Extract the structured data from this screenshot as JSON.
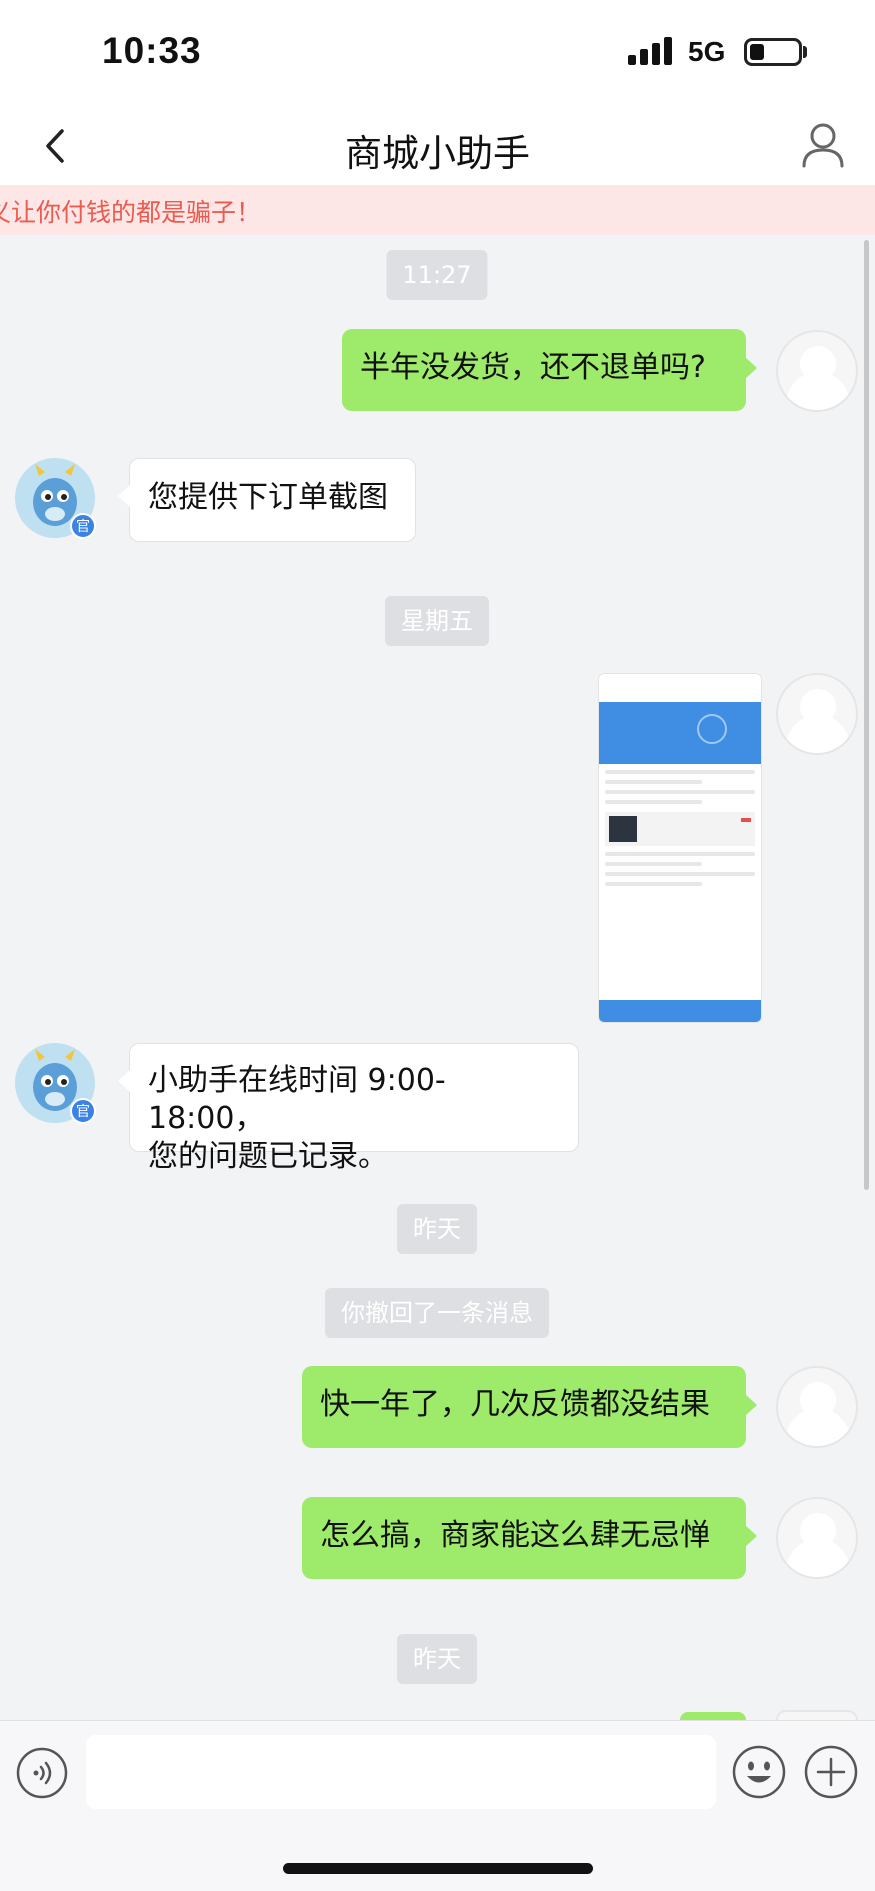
{
  "status_bar": {
    "time": "10:33",
    "network": "5G",
    "icons": [
      "signal-icon",
      "battery-icon"
    ]
  },
  "header": {
    "title": "商城小助手",
    "icons": [
      "back-icon",
      "profile-icon"
    ]
  },
  "banner": {
    "text": "义让你付钱的都是骗子！",
    "color": "#ec5b50"
  },
  "chat": {
    "messages": [
      {
        "type": "time",
        "text": "11:27"
      },
      {
        "type": "text",
        "from": "me",
        "text": "半年没发货，还不退单吗?"
      },
      {
        "type": "text",
        "from": "assistant",
        "text": "您提供下订单截图",
        "badge": "官"
      },
      {
        "type": "time",
        "text": "星期五"
      },
      {
        "type": "image",
        "from": "me",
        "description": "order-screenshot"
      },
      {
        "type": "text",
        "from": "assistant",
        "lines": [
          "小助手在线时间 9:00-18:00，",
          "您的问题已记录。"
        ],
        "badge": "官"
      },
      {
        "type": "time",
        "text": "昨天"
      },
      {
        "type": "system",
        "text": "你撤回了一条消息"
      },
      {
        "type": "text",
        "from": "me",
        "text": "快一年了，几次反馈都没结果"
      },
      {
        "type": "text",
        "from": "me",
        "text": "怎么搞，商家能这么肆无忌惮"
      },
      {
        "type": "time",
        "text": "昨天"
      }
    ]
  },
  "input_bar": {
    "placeholder": "",
    "icons": [
      "voice-icon",
      "emoji-icon",
      "plus-icon"
    ]
  },
  "colors": {
    "my_bubble": "#9eea6a",
    "their_bubble": "#ffffff",
    "background": "#f2f3f5",
    "accent_blue": "#3f8ee3"
  }
}
